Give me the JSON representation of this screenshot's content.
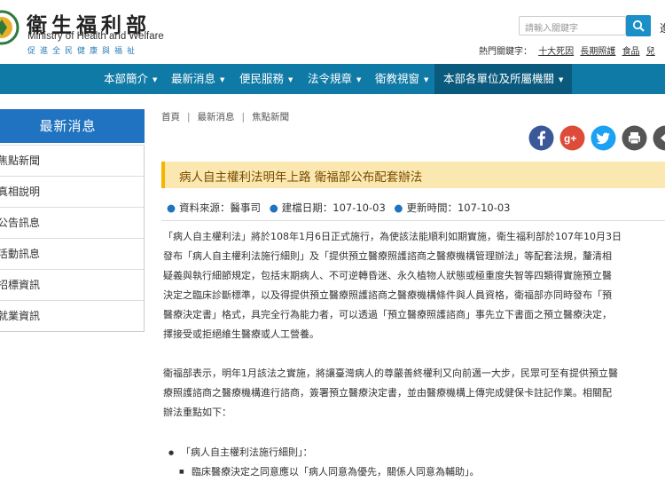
{
  "header": {
    "title_zh": "衛生福利部",
    "title_en": "Ministry of Health and Welfare",
    "slogan": "促進全民健康與福祉",
    "search_placeholder": "請輸入關鍵字",
    "cut_text": "進",
    "hot_label": "熱門關鍵字：",
    "hot_keywords": [
      "十大死因",
      "長期照護",
      "食品",
      "兒"
    ]
  },
  "nav": {
    "items": [
      "本部簡介",
      "最新消息",
      "便民服務",
      "法令規章",
      "衛教視窗",
      "本部各單位及所屬機關"
    ],
    "caret": "▼"
  },
  "sidebar": {
    "title": "最新消息",
    "items": [
      "焦點新聞",
      "真相說明",
      "公告訊息",
      "活動訊息",
      "招標資訊",
      "就業資訊"
    ]
  },
  "breadcrumb": [
    "首頁",
    "最新消息",
    "焦點新聞"
  ],
  "article": {
    "title": "病人自主權利法明年上路 衛福部公布配套辦法",
    "source": "資料來源：醫事司",
    "created": "建檔日期：107-10-03",
    "updated": "更新時間：107-10-03",
    "p1": [
      "「病人自主權利法」將於108年1月6日正式施行，為使該法能順利如期實施，衛生福利部於107年10月3日",
      "發布「病人自主權利法施行細則」及「提供預立醫療照護諮商之醫療機構管理辦法」等配套法規，釐清相",
      "疑義與執行細節規定，包括末期病人、不可逆轉昏迷、永久植物人狀態或極重度失智等四類得實施預立醫",
      "決定之臨床診斷標準，以及得提供預立醫療照護諮商之醫療機構條件與人員資格，衛福部亦同時發布「預",
      "醫療決定書」格式，具完全行為能力者，可以透過「預立醫療照護諮商」事先立下書面之預立醫療決定，",
      "擇接受或拒絕維生醫療或人工營養。"
    ],
    "p2": [
      "衛福部表示，明年1月該法之實施，將讓臺灣病人的尊嚴善終權利又向前邁一大步，民眾可至有提供預立醫",
      "療照護諮商之醫療機構進行諮商，簽署預立醫療決定書，並由醫療機構上傳完成健保卡註記作業。相關配",
      "辦法重點如下："
    ],
    "bullet1": "「病人自主權利法施行細則」：",
    "bullet2": "臨床醫療決定之同意應以「病人同意為優先，關係人同意為輔助」。"
  },
  "colors": {
    "nav_bg": "#0f7aa6",
    "nav_active": "#0a5a7e",
    "sidebar_title_bg": "#1f73c0",
    "title_bar_bg": "#fbe8b1",
    "facebook": "#3b5998",
    "googleplus": "#dd4b39",
    "twitter": "#1da1f2",
    "print": "#555555"
  },
  "icons": [
    "search-icon",
    "facebook-icon",
    "google-plus-icon",
    "twitter-icon",
    "print-icon",
    "share-icon"
  ]
}
